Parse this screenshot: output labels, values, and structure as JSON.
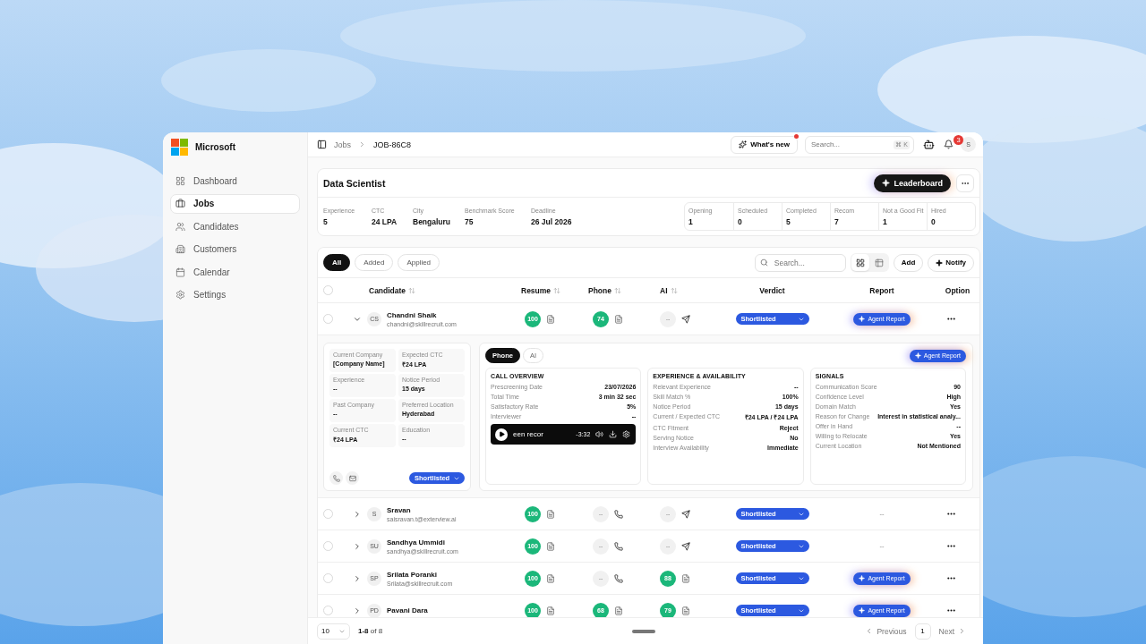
{
  "brand": {
    "name": "Microsoft"
  },
  "sidebar": {
    "items": [
      {
        "label": "Dashboard",
        "selected": false
      },
      {
        "label": "Jobs",
        "selected": true
      },
      {
        "label": "Candidates",
        "selected": false
      },
      {
        "label": "Customers",
        "selected": false
      },
      {
        "label": "Calendar",
        "selected": false
      },
      {
        "label": "Settings",
        "selected": false
      }
    ]
  },
  "topbar": {
    "breadcrumb": [
      {
        "label": "Jobs"
      },
      {
        "label": "JOB-86C8"
      }
    ],
    "whats_new": {
      "label": "What's new",
      "unread": true
    },
    "search": {
      "placeholder": "Search...",
      "shortcut": "⌘ K"
    },
    "notifications": {
      "count": "3"
    },
    "avatar": {
      "initials": "S"
    }
  },
  "job": {
    "title": "Data Scientist",
    "leaderboard": "Leaderboard",
    "details": [
      {
        "label": "Experience",
        "value": "5"
      },
      {
        "label": "CTC",
        "value": "24 LPA"
      },
      {
        "label": "City",
        "value": "Bengaluru"
      },
      {
        "label": "Benchmark Score",
        "value": "75"
      },
      {
        "label": "Deadline",
        "value": "26 Jul 2026"
      }
    ],
    "stats": [
      {
        "label": "Opening",
        "value": "1"
      },
      {
        "label": "Scheduled",
        "value": "0"
      },
      {
        "label": "Completed",
        "value": "5"
      },
      {
        "label": "Recom",
        "value": "7"
      },
      {
        "label": "Not a Good Fit",
        "value": "1"
      },
      {
        "label": "Hired",
        "value": "0"
      }
    ]
  },
  "candidates": {
    "filters": [
      {
        "label": "All",
        "selected": true
      },
      {
        "label": "Added",
        "selected": false
      },
      {
        "label": "Applied",
        "selected": false
      }
    ],
    "search": {
      "placeholder": "Search..."
    },
    "select_all": {
      "checked": false
    },
    "views": [
      {
        "kind": "grid",
        "selected": true
      },
      {
        "kind": "table",
        "selected": false
      }
    ],
    "actions": [
      {
        "label": "Add",
        "kind": "plain"
      },
      {
        "label": "Notify",
        "kind": "sparkle"
      }
    ],
    "columns": [
      {
        "label": "Candidate",
        "sortable": true
      },
      {
        "label": "Resume",
        "sortable": true
      },
      {
        "label": "Phone",
        "sortable": true
      },
      {
        "label": "AI",
        "sortable": true
      },
      {
        "label": "Verdict",
        "sortable": false
      },
      {
        "label": "Report",
        "sortable": false
      },
      {
        "label": "Option",
        "sortable": false
      }
    ],
    "rows": [
      {
        "checked": false,
        "expanded": true,
        "initials": "CS",
        "name": "Chandni Shaik",
        "email": "chandni@skillrecruit.com",
        "resume": {
          "kind": "score",
          "value": "100"
        },
        "phone": {
          "kind": "score",
          "value": "74"
        },
        "ai": {
          "kind": "empty",
          "value": "--"
        },
        "verdict": "Shortlisted",
        "report": {
          "kind": "button",
          "label": "Agent Report"
        },
        "details": {
          "fields": [
            {
              "label": "Current Company",
              "value": "[Company Name]"
            },
            {
              "label": "Expected CTC",
              "value": "₹24 LPA"
            },
            {
              "label": "Experience",
              "value": "--"
            },
            {
              "label": "Notice Period",
              "value": "15 days"
            },
            {
              "label": "Past Company",
              "value": "--"
            },
            {
              "label": "Preferred Location",
              "value": "Hyderabad"
            },
            {
              "label": "Current CTC",
              "value": "₹24 LPA"
            },
            {
              "label": "Education",
              "value": "--"
            }
          ],
          "verdict": "Shortlisted",
          "tabs": [
            {
              "label": "Phone",
              "selected": true
            },
            {
              "label": "AI",
              "selected": false
            }
          ],
          "report": "Agent Report",
          "sections": [
            {
              "title": "CALL OVERVIEW",
              "rows": [
                {
                  "label": "Prescreening Date",
                  "value": "23/07/2026"
                },
                {
                  "label": "Total Time",
                  "value": "3 min 32 sec"
                },
                {
                  "label": "Satisfactory Rate",
                  "value": "5%"
                },
                {
                  "label": "Interviewer",
                  "value": "--"
                }
              ],
              "player": {
                "caption": "een recor",
                "time": "-3:32"
              }
            },
            {
              "title": "EXPERIENCE & AVAILABILITY",
              "rows": [
                {
                  "label": "Relevant Experience",
                  "value": "--"
                },
                {
                  "label": "Skill Match %",
                  "value": "100%"
                },
                {
                  "label": "Notice Period",
                  "value": "15 days"
                },
                {
                  "label": "Current / Expected CTC",
                  "value": "₹24 LPA / ₹24 LPA"
                },
                {
                  "label": "CTC Fitment",
                  "value": "Reject"
                },
                {
                  "label": "Serving Notice",
                  "value": "No"
                },
                {
                  "label": "Interview Availability",
                  "value": "Immediate"
                }
              ]
            },
            {
              "title": "SIGNALS",
              "rows": [
                {
                  "label": "Communication Score",
                  "value": "90"
                },
                {
                  "label": "Confidence Level",
                  "value": "High"
                },
                {
                  "label": "Domain Match",
                  "value": "Yes"
                },
                {
                  "label": "Reason for Change",
                  "value": "Interest in statistical analy..."
                },
                {
                  "label": "Offer in Hand",
                  "value": "--"
                },
                {
                  "label": "Willing to Relocate",
                  "value": "Yes"
                },
                {
                  "label": "Current Location",
                  "value": "Not Mentioned"
                }
              ]
            }
          ]
        }
      },
      {
        "checked": false,
        "expanded": false,
        "initials": "S",
        "name": "Sravan",
        "email": "saisravan.t@exterview.ai",
        "resume": {
          "kind": "score",
          "value": "100"
        },
        "phone": {
          "kind": "empty",
          "value": "--"
        },
        "ai": {
          "kind": "empty",
          "value": "--"
        },
        "verdict": "Shortlisted",
        "report": {
          "kind": "none",
          "label": "--"
        }
      },
      {
        "checked": false,
        "expanded": false,
        "initials": "SU",
        "name": "Sandhya Ummidi",
        "email": "sandhya@skillrecruit.com",
        "resume": {
          "kind": "score",
          "value": "100"
        },
        "phone": {
          "kind": "empty",
          "value": "--"
        },
        "ai": {
          "kind": "empty",
          "value": "--"
        },
        "verdict": "Shortlisted",
        "report": {
          "kind": "none",
          "label": "--"
        }
      },
      {
        "checked": false,
        "expanded": false,
        "initials": "SP",
        "name": "Srilata Poranki",
        "email": "Srilata@skillrecruit.com",
        "resume": {
          "kind": "score",
          "value": "100"
        },
        "phone": {
          "kind": "empty",
          "value": "--"
        },
        "ai": {
          "kind": "score",
          "value": "88"
        },
        "verdict": "Shortlisted",
        "report": {
          "kind": "button",
          "label": "Agent Report"
        }
      },
      {
        "checked": false,
        "expanded": false,
        "initials": "PD",
        "name": "Pavani Dara",
        "resume": {
          "kind": "score",
          "value": "100"
        },
        "phone": {
          "kind": "score",
          "value": "68"
        },
        "ai": {
          "kind": "score",
          "value": "79"
        },
        "verdict": "Shortlisted",
        "report": {
          "kind": "button",
          "label": "Agent Report"
        }
      }
    ]
  },
  "pagination": {
    "page_size": "10",
    "range": "**1-8** of 8",
    "previous": "Previous",
    "page": "1",
    "next": "Next"
  }
}
